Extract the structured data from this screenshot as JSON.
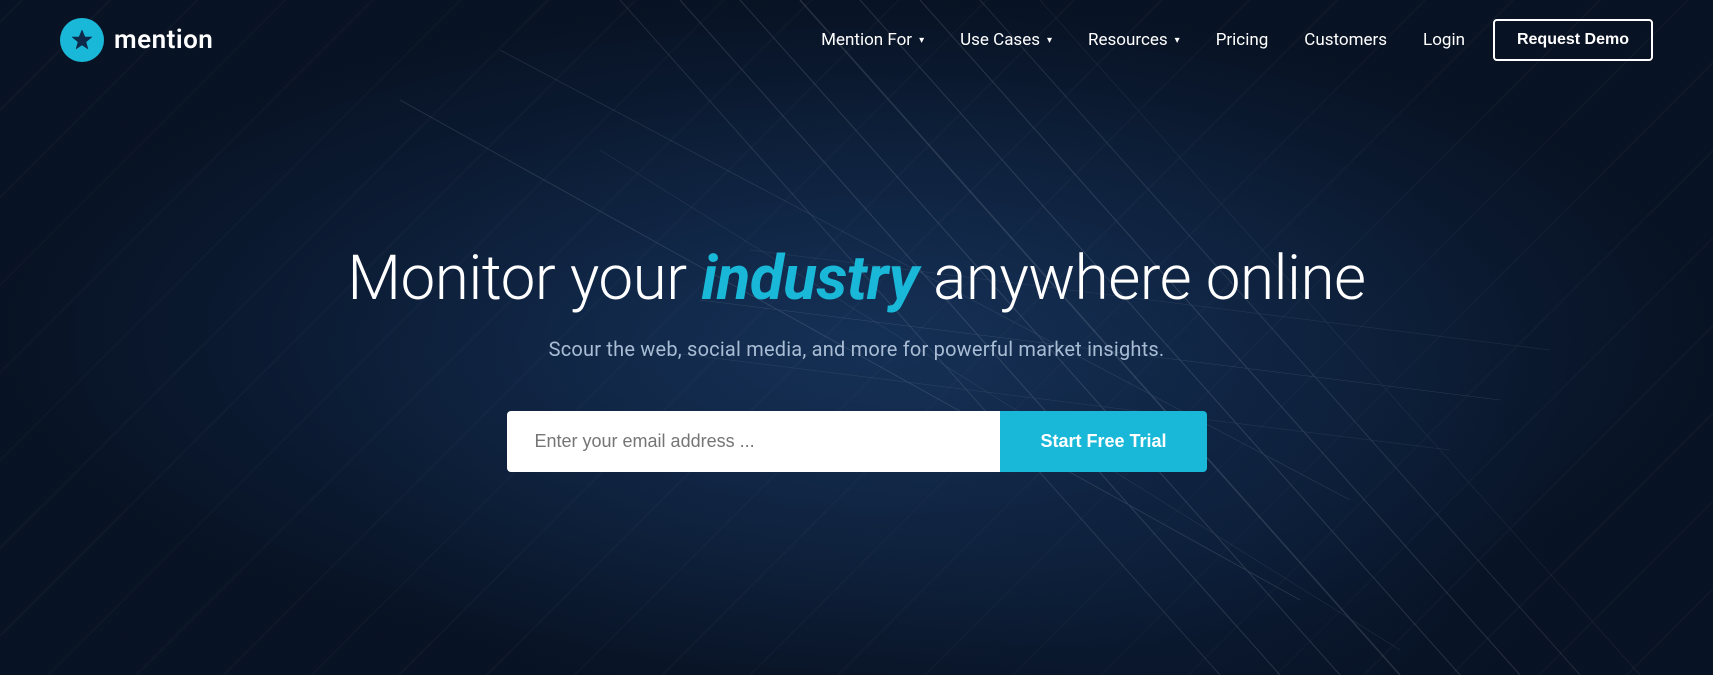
{
  "logo": {
    "text": "mention",
    "aria": "Mention home"
  },
  "nav": {
    "items": [
      {
        "label": "Mention For",
        "has_dropdown": true
      },
      {
        "label": "Use Cases",
        "has_dropdown": true
      },
      {
        "label": "Resources",
        "has_dropdown": true
      },
      {
        "label": "Pricing",
        "has_dropdown": false
      },
      {
        "label": "Customers",
        "has_dropdown": false
      },
      {
        "label": "Login",
        "has_dropdown": false
      }
    ],
    "cta_label": "Request Demo"
  },
  "hero": {
    "title_prefix": "Monitor your ",
    "title_highlight": "industry",
    "title_suffix": " anywhere online",
    "subtitle": "Scour the web, social media, and more for powerful market insights.",
    "email_placeholder": "Enter your email address ...",
    "cta_label": "Start Free Trial"
  },
  "colors": {
    "accent": "#1ab8d8",
    "bg_dark": "#0d1f3c",
    "text_muted": "#a8bcd4"
  }
}
